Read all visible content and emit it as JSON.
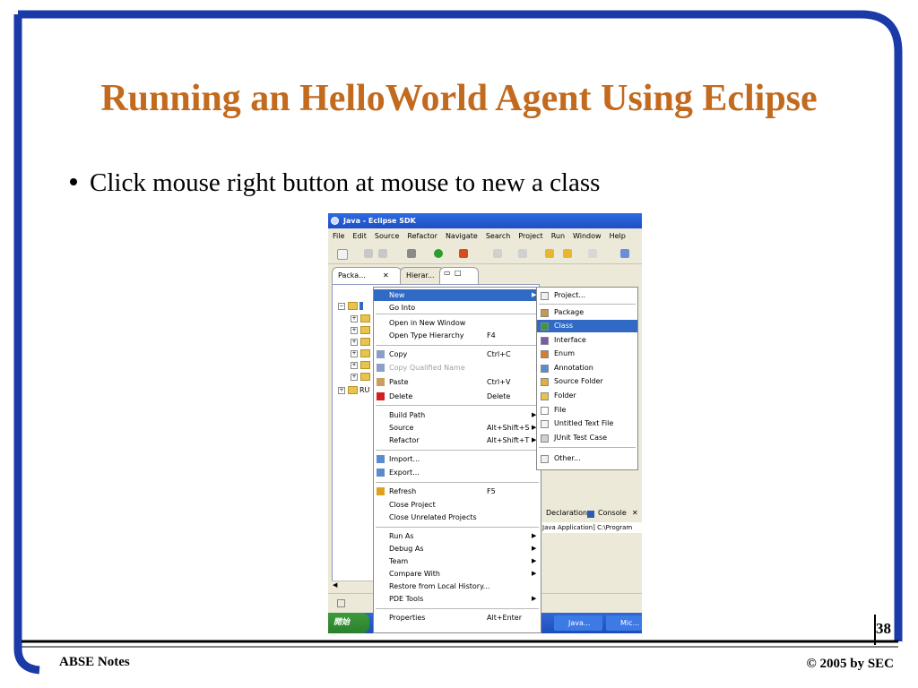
{
  "slide": {
    "title": "Running an HelloWorld Agent Using Eclipse",
    "bullet": "Click mouse right button at mouse to new a class",
    "page_number": "38",
    "footer_left": "ABSE Notes",
    "footer_right": "© 2005  by SEC"
  },
  "colors": {
    "title": "#c26a1e",
    "frame_blue": "#1a3aa8",
    "selection": "#316ac5"
  },
  "eclipse": {
    "window_title": "Java - Eclipse SDK",
    "menus": [
      "File",
      "Edit",
      "Source",
      "Refactor",
      "Navigate",
      "Search",
      "Project",
      "Run",
      "Window",
      "Help"
    ],
    "view_tabs": [
      "Packa...",
      "Hierar..."
    ],
    "tree_items": [
      "",
      "",
      "",
      "",
      "",
      "",
      "",
      "RU"
    ],
    "bottom_tabs": [
      "Declaration",
      "Console"
    ],
    "console_line": "Java Application] C:\\Program",
    "taskbar": {
      "start": "開始",
      "items": [
        "Java...",
        "Mic..."
      ]
    },
    "context_menu": {
      "items": [
        {
          "label": "New",
          "shortcut": "",
          "icon": "none",
          "submenu": true,
          "highlighted": true
        },
        {
          "label": "Go Into",
          "shortcut": "",
          "icon": "none",
          "submenu": false
        },
        {
          "label": "Open in New Window",
          "shortcut": "",
          "icon": "none",
          "submenu": false
        },
        {
          "label": "Open Type Hierarchy",
          "shortcut": "F4",
          "icon": "none",
          "submenu": false
        },
        {
          "label": "Copy",
          "shortcut": "Ctrl+C",
          "icon": "copy-icon",
          "submenu": false
        },
        {
          "label": "Copy Qualified Name",
          "shortcut": "",
          "icon": "copy-icon",
          "submenu": false,
          "disabled": true
        },
        {
          "label": "Paste",
          "shortcut": "Ctrl+V",
          "icon": "paste-icon",
          "submenu": false
        },
        {
          "label": "Delete",
          "shortcut": "Delete",
          "icon": "delete-icon",
          "submenu": false
        },
        {
          "label": "Build Path",
          "shortcut": "",
          "icon": "none",
          "submenu": true
        },
        {
          "label": "Source",
          "shortcut": "Alt+Shift+S",
          "icon": "none",
          "submenu": true
        },
        {
          "label": "Refactor",
          "shortcut": "Alt+Shift+T",
          "icon": "none",
          "submenu": true
        },
        {
          "label": "Import...",
          "shortcut": "",
          "icon": "import-icon",
          "submenu": false
        },
        {
          "label": "Export...",
          "shortcut": "",
          "icon": "export-icon",
          "submenu": false
        },
        {
          "label": "Refresh",
          "shortcut": "F5",
          "icon": "refresh-icon",
          "submenu": false
        },
        {
          "label": "Close Project",
          "shortcut": "",
          "icon": "none",
          "submenu": false
        },
        {
          "label": "Close Unrelated Projects",
          "shortcut": "",
          "icon": "none",
          "submenu": false
        },
        {
          "label": "Run As",
          "shortcut": "",
          "icon": "none",
          "submenu": true
        },
        {
          "label": "Debug As",
          "shortcut": "",
          "icon": "none",
          "submenu": true
        },
        {
          "label": "Team",
          "shortcut": "",
          "icon": "none",
          "submenu": true
        },
        {
          "label": "Compare With",
          "shortcut": "",
          "icon": "none",
          "submenu": true
        },
        {
          "label": "Restore from Local History...",
          "shortcut": "",
          "icon": "none",
          "submenu": false
        },
        {
          "label": "PDE Tools",
          "shortcut": "",
          "icon": "none",
          "submenu": true
        },
        {
          "label": "Properties",
          "shortcut": "Alt+Enter",
          "icon": "none",
          "submenu": false
        }
      ]
    },
    "new_submenu": {
      "items": [
        {
          "label": "Project...",
          "icon": "project-icon",
          "highlighted": false
        },
        {
          "label": "Package",
          "icon": "package-icon",
          "highlighted": false
        },
        {
          "label": "Class",
          "icon": "class-icon",
          "highlighted": true
        },
        {
          "label": "Interface",
          "icon": "interface-icon",
          "highlighted": false
        },
        {
          "label": "Enum",
          "icon": "enum-icon",
          "highlighted": false
        },
        {
          "label": "Annotation",
          "icon": "annotation-icon",
          "highlighted": false
        },
        {
          "label": "Source Folder",
          "icon": "source-folder-icon",
          "highlighted": false
        },
        {
          "label": "Folder",
          "icon": "folder-icon",
          "highlighted": false
        },
        {
          "label": "File",
          "icon": "file-icon",
          "highlighted": false
        },
        {
          "label": "Untitled Text File",
          "icon": "text-file-icon",
          "highlighted": false
        },
        {
          "label": "JUnit Test Case",
          "icon": "junit-icon",
          "highlighted": false
        },
        {
          "label": "Other...",
          "icon": "other-icon",
          "highlighted": false
        }
      ]
    }
  }
}
